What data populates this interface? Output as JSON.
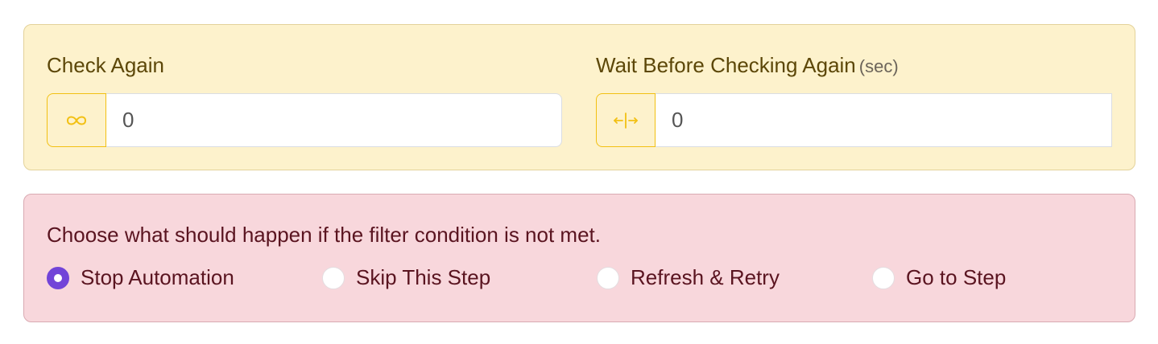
{
  "retry": {
    "check_again": {
      "label": "Check Again",
      "icon": "infinity-icon",
      "value": "0"
    },
    "wait": {
      "label": "Wait Before Checking Again",
      "unit": "(sec)",
      "icon": "horizontal-resize-icon",
      "value": "0"
    }
  },
  "filter_failure": {
    "prompt": "Choose what should happen if the filter condition is not met.",
    "options": [
      {
        "label": "Stop Automation",
        "selected": true
      },
      {
        "label": "Skip This Step",
        "selected": false
      },
      {
        "label": "Refresh & Retry",
        "selected": false
      },
      {
        "label": "Go to Step",
        "selected": false
      }
    ]
  },
  "colors": {
    "accent": "#f2c012",
    "radio_selected": "#7244d8",
    "yellow_panel": "#fdf2cc",
    "red_panel": "#f8d7dc"
  }
}
